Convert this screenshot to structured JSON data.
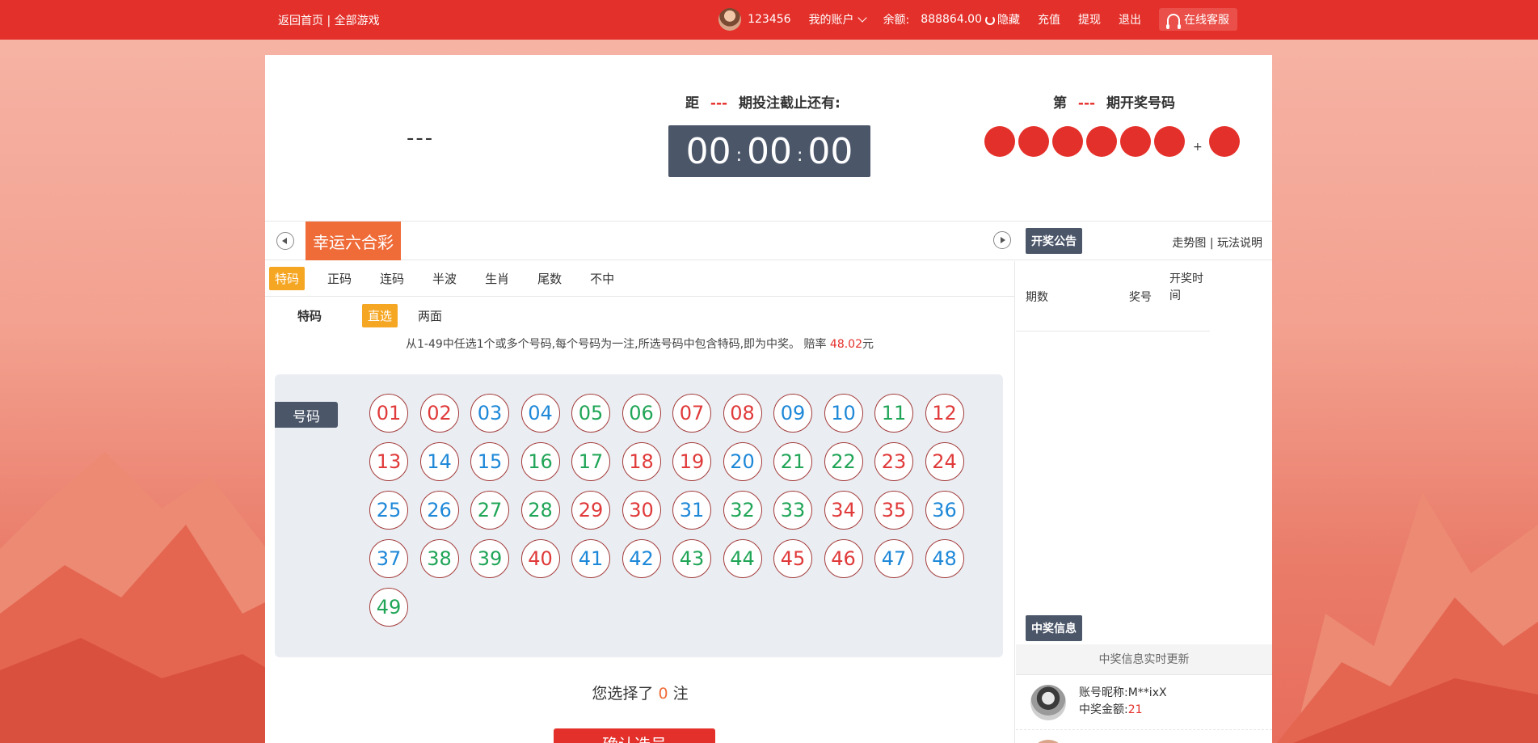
{
  "topbar": {
    "home_link": "返回首页",
    "separator": "|",
    "all_games_link": "全部游戏",
    "username": "123456",
    "my_account": "我的账户",
    "balance_label": "余额:",
    "balance_value": "888864.00",
    "hide_label": "隐藏",
    "recharge": "充值",
    "withdraw": "提现",
    "logout": "退出",
    "service": "在线客服"
  },
  "header": {
    "game_name_placeholder": "---",
    "countdown_prefix": "距",
    "countdown_period": "---",
    "countdown_suffix": "期投注截止还有:",
    "timer_hours": "00",
    "timer_minutes": "00",
    "timer_seconds": "00",
    "timer_sep": ":",
    "draw_prefix": "第",
    "draw_period": "---",
    "draw_suffix": "期开奖号码",
    "plus": "+"
  },
  "game_tabs": {
    "active_game": "幸运六合彩",
    "notice_label": "开奖公告",
    "trend_link": "走势图",
    "link_separator": "|",
    "rules_link": "玩法说明"
  },
  "play_tabs": [
    {
      "label": "特码",
      "active": true
    },
    {
      "label": "正码",
      "active": false
    },
    {
      "label": "连码",
      "active": false
    },
    {
      "label": "半波",
      "active": false
    },
    {
      "label": "生肖",
      "active": false
    },
    {
      "label": "尾数",
      "active": false
    },
    {
      "label": "不中",
      "active": false
    }
  ],
  "sub_play": {
    "label": "特码",
    "options": [
      {
        "label": "直选",
        "active": true
      },
      {
        "label": "两面",
        "active": false
      }
    ]
  },
  "rule": {
    "text": "从1-49中任选1个或多个号码,每个号码为一注,所选号码中包含特码,即为中奖。 赔率 ",
    "odds": "48.02",
    "unit": "元"
  },
  "board": {
    "label": "号码",
    "numbers": [
      {
        "n": "01",
        "c": "red"
      },
      {
        "n": "02",
        "c": "red"
      },
      {
        "n": "03",
        "c": "blue"
      },
      {
        "n": "04",
        "c": "blue"
      },
      {
        "n": "05",
        "c": "green"
      },
      {
        "n": "06",
        "c": "green"
      },
      {
        "n": "07",
        "c": "red"
      },
      {
        "n": "08",
        "c": "red"
      },
      {
        "n": "09",
        "c": "blue"
      },
      {
        "n": "10",
        "c": "blue"
      },
      {
        "n": "11",
        "c": "green"
      },
      {
        "n": "12",
        "c": "red"
      },
      {
        "n": "13",
        "c": "red"
      },
      {
        "n": "14",
        "c": "blue"
      },
      {
        "n": "15",
        "c": "blue"
      },
      {
        "n": "16",
        "c": "green"
      },
      {
        "n": "17",
        "c": "green"
      },
      {
        "n": "18",
        "c": "red"
      },
      {
        "n": "19",
        "c": "red"
      },
      {
        "n": "20",
        "c": "blue"
      },
      {
        "n": "21",
        "c": "green"
      },
      {
        "n": "22",
        "c": "green"
      },
      {
        "n": "23",
        "c": "red"
      },
      {
        "n": "24",
        "c": "red"
      },
      {
        "n": "25",
        "c": "blue"
      },
      {
        "n": "26",
        "c": "blue"
      },
      {
        "n": "27",
        "c": "green"
      },
      {
        "n": "28",
        "c": "green"
      },
      {
        "n": "29",
        "c": "red"
      },
      {
        "n": "30",
        "c": "red"
      },
      {
        "n": "31",
        "c": "blue"
      },
      {
        "n": "32",
        "c": "green"
      },
      {
        "n": "33",
        "c": "green"
      },
      {
        "n": "34",
        "c": "red"
      },
      {
        "n": "35",
        "c": "red"
      },
      {
        "n": "36",
        "c": "blue"
      },
      {
        "n": "37",
        "c": "blue"
      },
      {
        "n": "38",
        "c": "green"
      },
      {
        "n": "39",
        "c": "green"
      },
      {
        "n": "40",
        "c": "red"
      },
      {
        "n": "41",
        "c": "blue"
      },
      {
        "n": "42",
        "c": "blue"
      },
      {
        "n": "43",
        "c": "green"
      },
      {
        "n": "44",
        "c": "green"
      },
      {
        "n": "45",
        "c": "red"
      },
      {
        "n": "46",
        "c": "red"
      },
      {
        "n": "47",
        "c": "blue"
      },
      {
        "n": "48",
        "c": "blue"
      },
      {
        "n": "49",
        "c": "green"
      }
    ]
  },
  "selection": {
    "prefix": "您选择了 ",
    "count": "0",
    "suffix": " 注",
    "confirm_button": "确认选号"
  },
  "sidebar": {
    "col_period": "期数",
    "col_number": "奖号",
    "col_time": "开奖时间",
    "winner_label": "中奖信息",
    "winner_sub": "中奖信息实时更新",
    "winner": {
      "nick_label": "账号昵称:",
      "nick": "M**ixX",
      "amount_label": "中奖金额:",
      "amount": "21"
    }
  },
  "colors": {
    "topbar": "#e4302a",
    "accent_orange": "#f5a623",
    "game_tab": "#ef6b38",
    "slate": "#4b5669",
    "num_red": "#e03a3a",
    "num_blue": "#1e88d8",
    "num_green": "#20a557"
  }
}
